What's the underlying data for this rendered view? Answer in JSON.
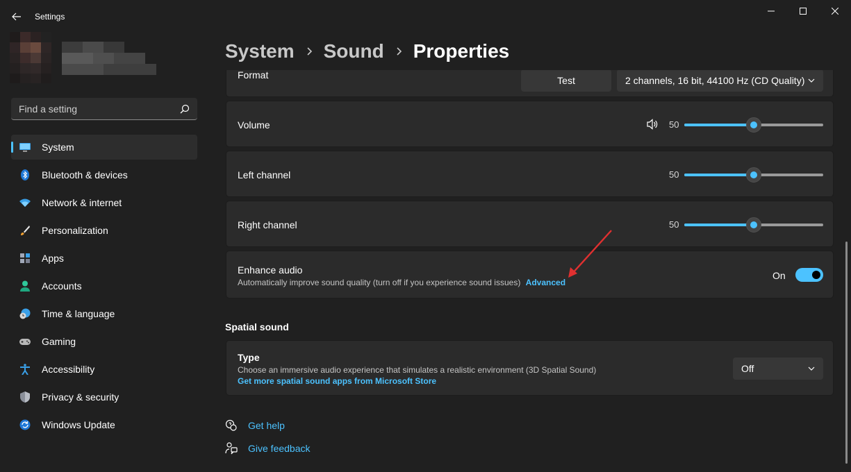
{
  "window": {
    "title": "Settings"
  },
  "breadcrumb": {
    "items": [
      "System",
      "Sound",
      "Properties"
    ]
  },
  "search": {
    "placeholder": "Find a setting"
  },
  "sidebar": {
    "items": [
      {
        "label": "System",
        "icon": "monitor-icon",
        "active": true
      },
      {
        "label": "Bluetooth & devices",
        "icon": "bluetooth-icon"
      },
      {
        "label": "Network & internet",
        "icon": "wifi-icon"
      },
      {
        "label": "Personalization",
        "icon": "brush-icon"
      },
      {
        "label": "Apps",
        "icon": "apps-icon"
      },
      {
        "label": "Accounts",
        "icon": "person-icon"
      },
      {
        "label": "Time & language",
        "icon": "globe-clock-icon"
      },
      {
        "label": "Gaming",
        "icon": "gamepad-icon"
      },
      {
        "label": "Accessibility",
        "icon": "accessibility-icon"
      },
      {
        "label": "Privacy & security",
        "icon": "shield-icon"
      },
      {
        "label": "Windows Update",
        "icon": "update-icon"
      }
    ]
  },
  "format": {
    "label": "Format",
    "test_label": "Test",
    "selected": "2 channels, 16 bit, 44100 Hz (CD Quality)"
  },
  "volume": {
    "label": "Volume",
    "value": "50",
    "level": 0.5
  },
  "left_channel": {
    "label": "Left channel",
    "value": "50",
    "level": 0.5
  },
  "right_channel": {
    "label": "Right channel",
    "value": "50",
    "level": 0.5
  },
  "enhance": {
    "title": "Enhance audio",
    "description": "Automatically improve sound quality (turn off if you experience sound issues)",
    "link": "Advanced",
    "state_label": "On",
    "enabled": true
  },
  "spatial": {
    "section_title": "Spatial sound",
    "type_label": "Type",
    "description": "Choose an immersive audio experience that simulates a realistic environment (3D Spatial Sound)",
    "link": "Get more spatial sound apps from Microsoft Store",
    "selected": "Off"
  },
  "help": {
    "get_help": "Get help",
    "give_feedback": "Give feedback"
  },
  "colors": {
    "accent": "#4cc2ff",
    "background": "#202020",
    "card": "#2b2b2b",
    "annotation_arrow": "#e03030"
  }
}
